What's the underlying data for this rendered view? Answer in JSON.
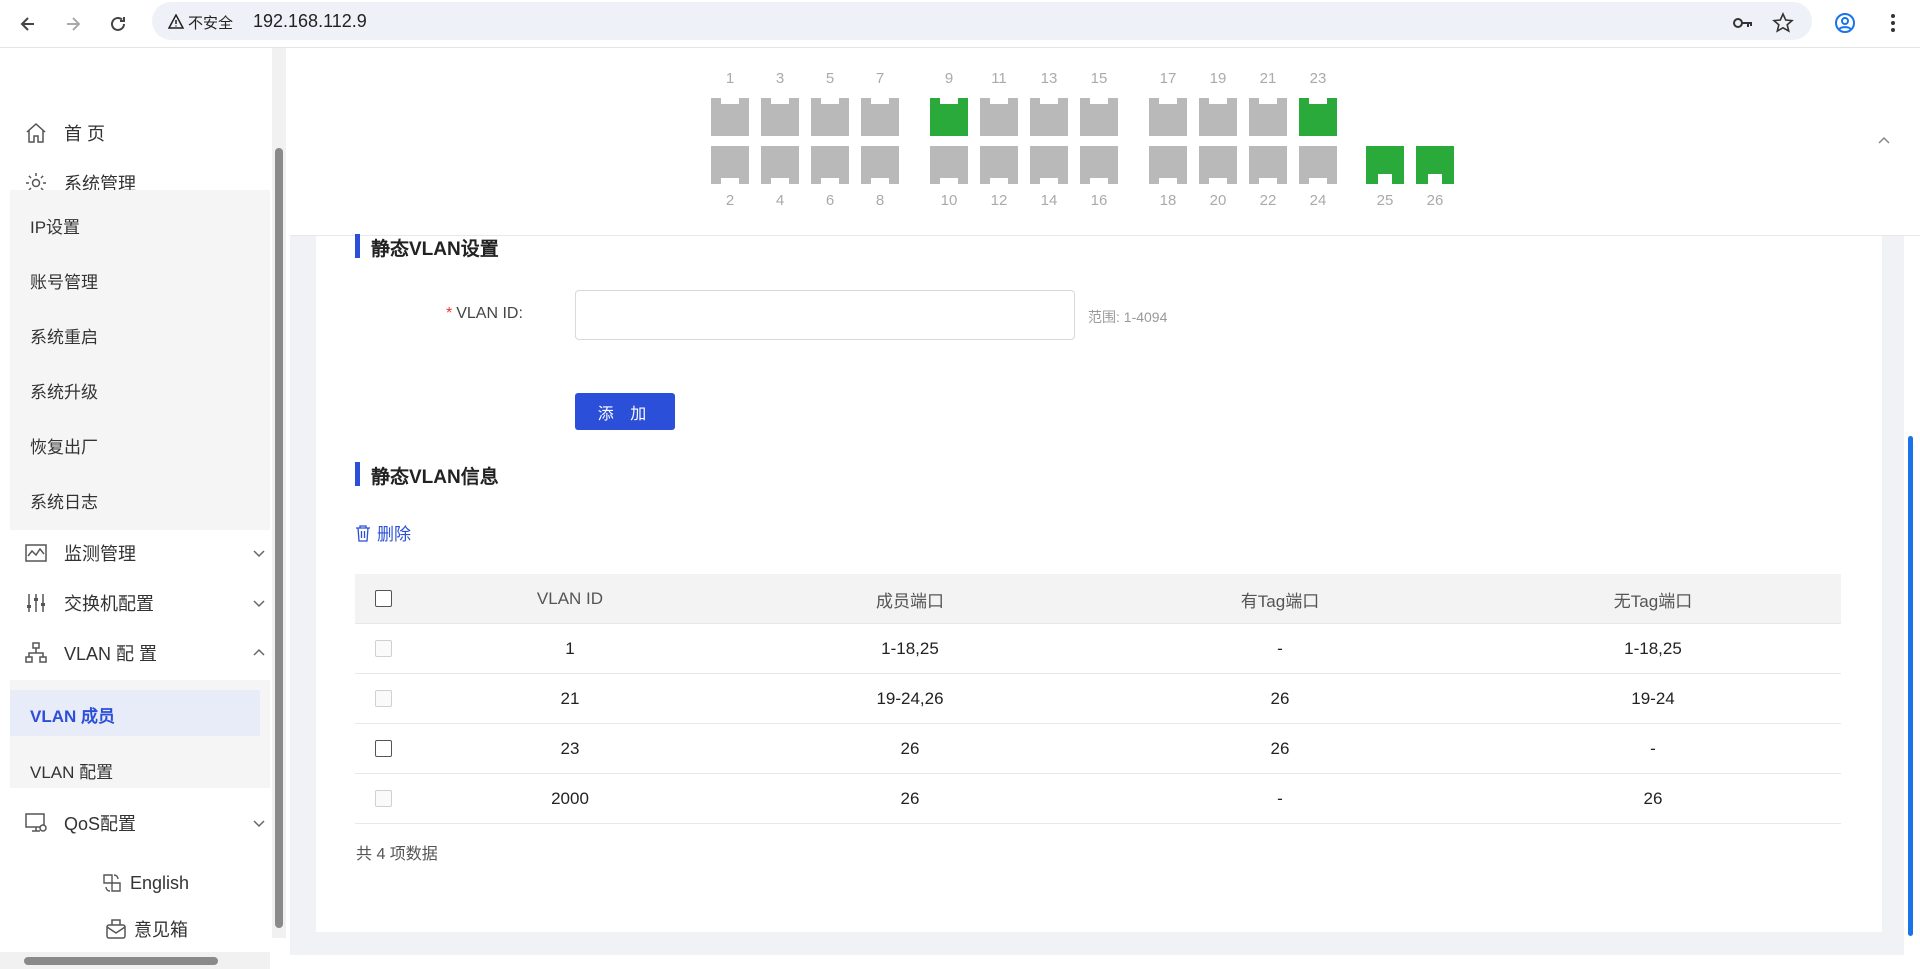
{
  "browser": {
    "security_label": "不安全",
    "url": "192.168.112.9",
    "icons": [
      "back-icon",
      "forward-icon",
      "reload-icon",
      "warning-icon",
      "key-icon",
      "star-icon",
      "profile-icon",
      "menu-icon"
    ]
  },
  "sidebar": {
    "home": "首 页",
    "system_mgmt": "系统管理",
    "system_items": [
      "IP设置",
      "账号管理",
      "系统重启",
      "系统升级",
      "恢复出厂",
      "系统日志"
    ],
    "monitor_mgmt": "监测管理",
    "switch_config": "交换机配置",
    "vlan_config": "VLAN 配 置",
    "vlan_items": [
      "VLAN 成员",
      "VLAN 配置"
    ],
    "active_item": "VLAN 成员",
    "qos_config": "QoS配置",
    "english": "English",
    "feedback": "意见箱"
  },
  "ports": {
    "top_labels": [
      "1",
      "3",
      "5",
      "7",
      "9",
      "11",
      "13",
      "15",
      "17",
      "19",
      "21",
      "23"
    ],
    "bottom_labels": [
      "2",
      "4",
      "6",
      "8",
      "10",
      "12",
      "14",
      "16",
      "18",
      "20",
      "22",
      "24"
    ],
    "sfp_labels": [
      "25",
      "26"
    ],
    "active_ports": [
      "9",
      "23",
      "25",
      "26"
    ],
    "colors": {
      "active": "#2aaa3b",
      "inactive": "#b9b9b9"
    }
  },
  "form": {
    "section_title": "静态VLAN设置",
    "required_mark": "*",
    "vlan_id_label": "VLAN ID:",
    "vlan_id_value": "",
    "range_hint": "范围: 1-4094",
    "add_button": "添 加"
  },
  "info": {
    "section_title": "静态VLAN信息",
    "delete_button": "删除",
    "columns": [
      "VLAN ID",
      "成员端口",
      "有Tag端口",
      "无Tag端口"
    ],
    "rows": [
      {
        "vlan_id": "1",
        "member": "1-18,25",
        "tagged": "-",
        "untagged": "1-18,25",
        "selectable": false
      },
      {
        "vlan_id": "21",
        "member": "19-24,26",
        "tagged": "26",
        "untagged": "19-24",
        "selectable": false
      },
      {
        "vlan_id": "23",
        "member": "26",
        "tagged": "26",
        "untagged": "-",
        "selectable": true
      },
      {
        "vlan_id": "2000",
        "member": "26",
        "tagged": "-",
        "untagged": "26",
        "selectable": false
      }
    ],
    "total": "共 4 项数据"
  },
  "theme": {
    "accent": "#2b4fd8",
    "required": "#e53935"
  }
}
